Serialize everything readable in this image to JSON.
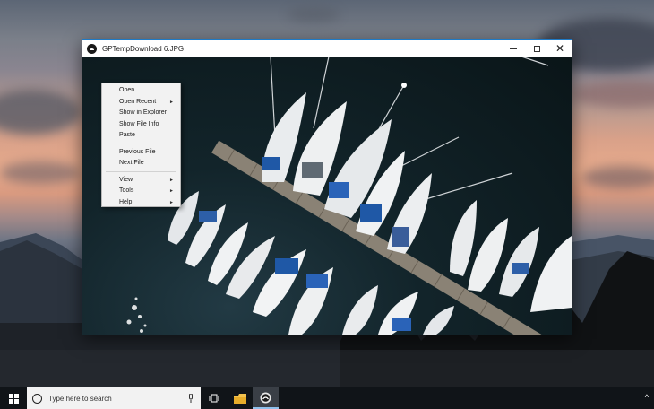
{
  "window": {
    "title": "GPTempDownload 6.JPG",
    "minimize_icon": "minimize-icon",
    "maximize_icon": "maximize-icon",
    "close_glyph": "✕"
  },
  "context_menu": {
    "items": [
      {
        "label": "Open",
        "submenu": false
      },
      {
        "label": "Open Recent",
        "submenu": true
      },
      {
        "label": "Show in Explorer",
        "submenu": false
      },
      {
        "label": "Show File Info",
        "submenu": false
      },
      {
        "label": "Paste",
        "submenu": false
      },
      {
        "label": "Previous File",
        "submenu": false
      },
      {
        "label": "Next File",
        "submenu": false
      },
      {
        "label": "View",
        "submenu": true
      },
      {
        "label": "Tools",
        "submenu": true
      },
      {
        "label": "Help",
        "submenu": true
      }
    ],
    "submenu_arrow": "►"
  },
  "taskbar": {
    "search_placeholder": "Type here to search",
    "start_icon": "windows-logo-icon",
    "tray_chevron": "^"
  },
  "colors": {
    "window_border": "#1e7ac6",
    "taskbar_bg": "#101418",
    "active_indicator": "#8fc0ec",
    "menu_bg": "#f2f2f2"
  }
}
